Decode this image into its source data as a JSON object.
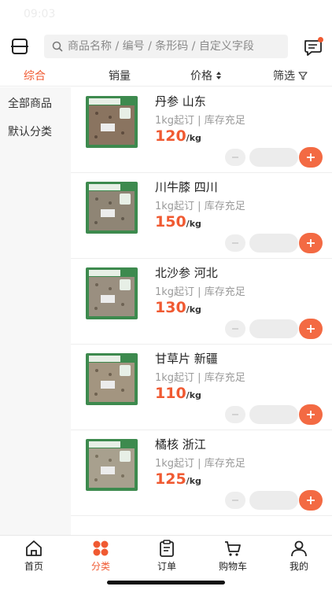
{
  "status_bar": {
    "time": "09:03"
  },
  "search": {
    "placeholder": "商品名称 / 编号 / 条形码 / 自定义字段"
  },
  "icons": {
    "scan": "scan-icon",
    "search": "search-icon",
    "message": "message-icon",
    "sort": "sort-arrows-icon",
    "filter": "filter-icon",
    "minus": "minus-icon",
    "plus": "plus-icon"
  },
  "colors": {
    "accent": "#f05a32",
    "plus_button": "#f36a43",
    "sidebar_bg": "#f7f7f7",
    "package_green": "#3d8a4e"
  },
  "sort_tabs": [
    {
      "label": "综合",
      "active": true
    },
    {
      "label": "销量"
    },
    {
      "label": "价格"
    },
    {
      "label": "筛选"
    }
  ],
  "sidebar": {
    "items": [
      {
        "label": "全部商品"
      },
      {
        "label": "默认分类"
      }
    ]
  },
  "products": [
    {
      "name": "丹参 山东",
      "meta": "1kg起订 | 库存充足",
      "price": "120",
      "unit": "/kg"
    },
    {
      "name": "川牛膝 四川",
      "meta": "1kg起订 | 库存充足",
      "price": "150",
      "unit": "/kg"
    },
    {
      "name": "北沙参 河北",
      "meta": "1kg起订 | 库存充足",
      "price": "130",
      "unit": "/kg"
    },
    {
      "name": "甘草片 新疆",
      "meta": "1kg起订 | 库存充足",
      "price": "110",
      "unit": "/kg"
    },
    {
      "name": "橘核 浙江",
      "meta": "1kg起订 | 库存充足",
      "price": "125",
      "unit": "/kg"
    }
  ],
  "bottom_nav": [
    {
      "label": "首页",
      "icon": "home-icon"
    },
    {
      "label": "分类",
      "icon": "category-icon",
      "active": true
    },
    {
      "label": "订单",
      "icon": "order-icon"
    },
    {
      "label": "购物车",
      "icon": "cart-icon"
    },
    {
      "label": "我的",
      "icon": "user-icon"
    }
  ]
}
